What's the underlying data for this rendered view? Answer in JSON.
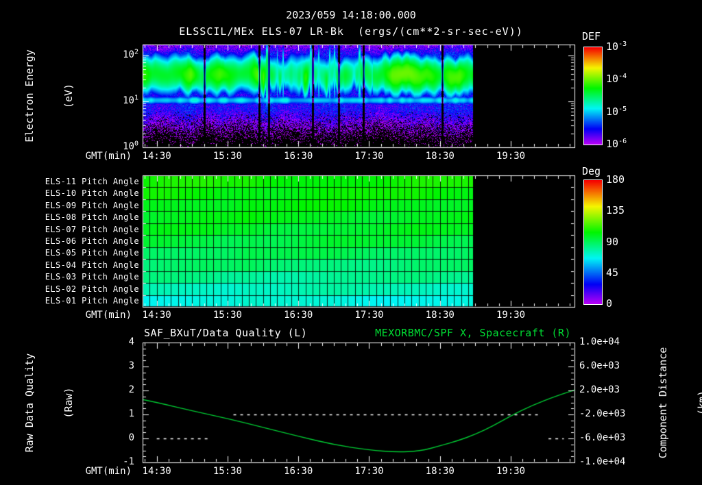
{
  "header": {
    "title": "2023/059 14:18:00.000",
    "subtitle": "ELSSCIL/MEx ELS-07 LR-Bk  (ergs/(cm**2-sr-sec-eV))"
  },
  "colors": {
    "accent_green": "#00dd33",
    "curve_green": "#00cc33",
    "text": "#ffffff",
    "background": "#000000"
  },
  "time_axis": {
    "label": "GMT(min)",
    "tick_labels": [
      "14:30",
      "15:30",
      "16:30",
      "17:30",
      "18:30",
      "19:30"
    ],
    "tick_minutes": [
      12,
      72,
      132,
      192,
      252,
      312
    ],
    "range_minutes": [
      0,
      366
    ],
    "minor_step_minutes": 10,
    "start_time": "14:18"
  },
  "spectrogram": {
    "colorbar_title": "DEF",
    "axis_label_line1": "Electron Energy",
    "axis_label_line2": "(eV)",
    "y_tick_exponents": [
      0,
      1,
      2
    ],
    "colorbar_tick_exponents": [
      -3,
      -4,
      -5,
      -6
    ]
  },
  "pitch": {
    "colorbar_title": "Deg",
    "colorbar_ticks": [
      180,
      135,
      90,
      45,
      0
    ]
  },
  "bottom": {
    "left_title": "SAF_BXuT/Data Quality (L)",
    "right_title": "MEXORBMC/SPF X, Spacecraft (R)",
    "left_axis_line1": "Raw Data Quality",
    "left_axis_line2": "(Raw)",
    "right_axis_line1": "Component Distance",
    "right_axis_line2": "(km)",
    "left_ticks": [
      4,
      3,
      2,
      1,
      0,
      -1
    ],
    "right_tick_labels": [
      "1.0e+04",
      "6.0e+03",
      "2.0e+03",
      "-2.0e+03",
      "-6.0e+03",
      "-1.0e+04"
    ]
  },
  "chart_data": [
    {
      "type": "heatmap",
      "name": "electron-energy-spectrogram",
      "title": "ELSSCIL/MEx ELS-07 LR-Bk",
      "units": "ergs/(cm**2-sr-sec-eV)",
      "xlabel": "GMT(min)",
      "ylabel": "Electron Energy (eV)",
      "x_start_time": "14:18:00.000",
      "x_tick_labels": [
        "14:30",
        "15:30",
        "16:30",
        "17:30",
        "18:30",
        "19:30"
      ],
      "y_scale": "log",
      "y_range_eV": [
        1,
        173
      ],
      "colorbar": {
        "title": "DEF",
        "log10_range": [
          -6,
          -3
        ],
        "tick_labels": [
          "10^-3",
          "10^-4",
          "10^-5",
          "10^-6"
        ]
      },
      "data_coverage_minutes": [
        0,
        280
      ],
      "features": {
        "main_band": {
          "energy_eV": [
            20,
            80
          ],
          "peak_log10_flux": -4.1
        },
        "low_band": {
          "energy_eV": [
            9,
            13
          ],
          "peak_log10_flux": -4.9
        },
        "background_log10_flux": -5.6,
        "disturbed_interval_minutes": [
          100,
          195
        ]
      }
    },
    {
      "type": "heatmap",
      "name": "pitch-angle-panel",
      "colorbar": {
        "title": "Deg",
        "range": [
          0,
          180
        ],
        "tick_labels": [
          "180",
          "135",
          "90",
          "45",
          "0"
        ]
      },
      "data_coverage_minutes": [
        0,
        280
      ],
      "rows": [
        {
          "label": "ELS-11 Pitch Angle",
          "value_deg": 106
        },
        {
          "label": "ELS-10 Pitch Angle",
          "value_deg": 104
        },
        {
          "label": "ELS-09 Pitch Angle",
          "value_deg": 102
        },
        {
          "label": "ELS-08 Pitch Angle",
          "value_deg": 100
        },
        {
          "label": "ELS-07 Pitch Angle",
          "value_deg": 98
        },
        {
          "label": "ELS-06 Pitch Angle",
          "value_deg": 95
        },
        {
          "label": "ELS-05 Pitch Angle",
          "value_deg": 91
        },
        {
          "label": "ELS-04 Pitch Angle",
          "value_deg": 87
        },
        {
          "label": "ELS-03 Pitch Angle",
          "value_deg": 82
        },
        {
          "label": "ELS-02 Pitch Angle",
          "value_deg": 76
        },
        {
          "label": "ELS-01 Pitch Angle",
          "value_deg": 70
        }
      ]
    },
    {
      "type": "line",
      "name": "quality-and-spacecraft-x",
      "left_axis": {
        "title": "Raw Data Quality (Raw)",
        "range": [
          -1,
          4
        ],
        "ticks": [
          4,
          3,
          2,
          1,
          0,
          -1
        ]
      },
      "right_axis": {
        "title": "Component Distance (km)",
        "range": [
          -10000,
          10000
        ],
        "tick_labels": [
          "1.0e+04",
          "6.0e+03",
          "2.0e+03",
          "-2.0e+03",
          "-6.0e+03",
          "-1.0e+04"
        ]
      },
      "series": [
        {
          "name": "MEXORBMC/SPF X, Spacecraft (R)",
          "style": "solid",
          "points": [
            [
              0,
              1.62
            ],
            [
              12,
              1.5
            ],
            [
              42,
              1.15
            ],
            [
              72,
              0.83
            ],
            [
              102,
              0.46
            ],
            [
              132,
              0.09
            ],
            [
              162,
              -0.26
            ],
            [
              192,
              -0.49
            ],
            [
              215,
              -0.57
            ],
            [
              235,
              -0.53
            ],
            [
              252,
              -0.31
            ],
            [
              267,
              -0.1
            ],
            [
              282,
              0.17
            ],
            [
              297,
              0.52
            ],
            [
              312,
              0.94
            ],
            [
              330,
              1.38
            ],
            [
              350,
              1.76
            ],
            [
              366,
              2.02
            ]
          ]
        },
        {
          "name": "SAF_BXuT/Data Quality (L)",
          "style": "dashed",
          "segments": [
            {
              "value": 0,
              "from_min": 12,
              "to_min": 57
            },
            {
              "value": 1,
              "from_min": 77,
              "to_min": 337
            },
            {
              "value": 0,
              "from_min": 344,
              "to_min": 357
            }
          ]
        }
      ]
    }
  ]
}
